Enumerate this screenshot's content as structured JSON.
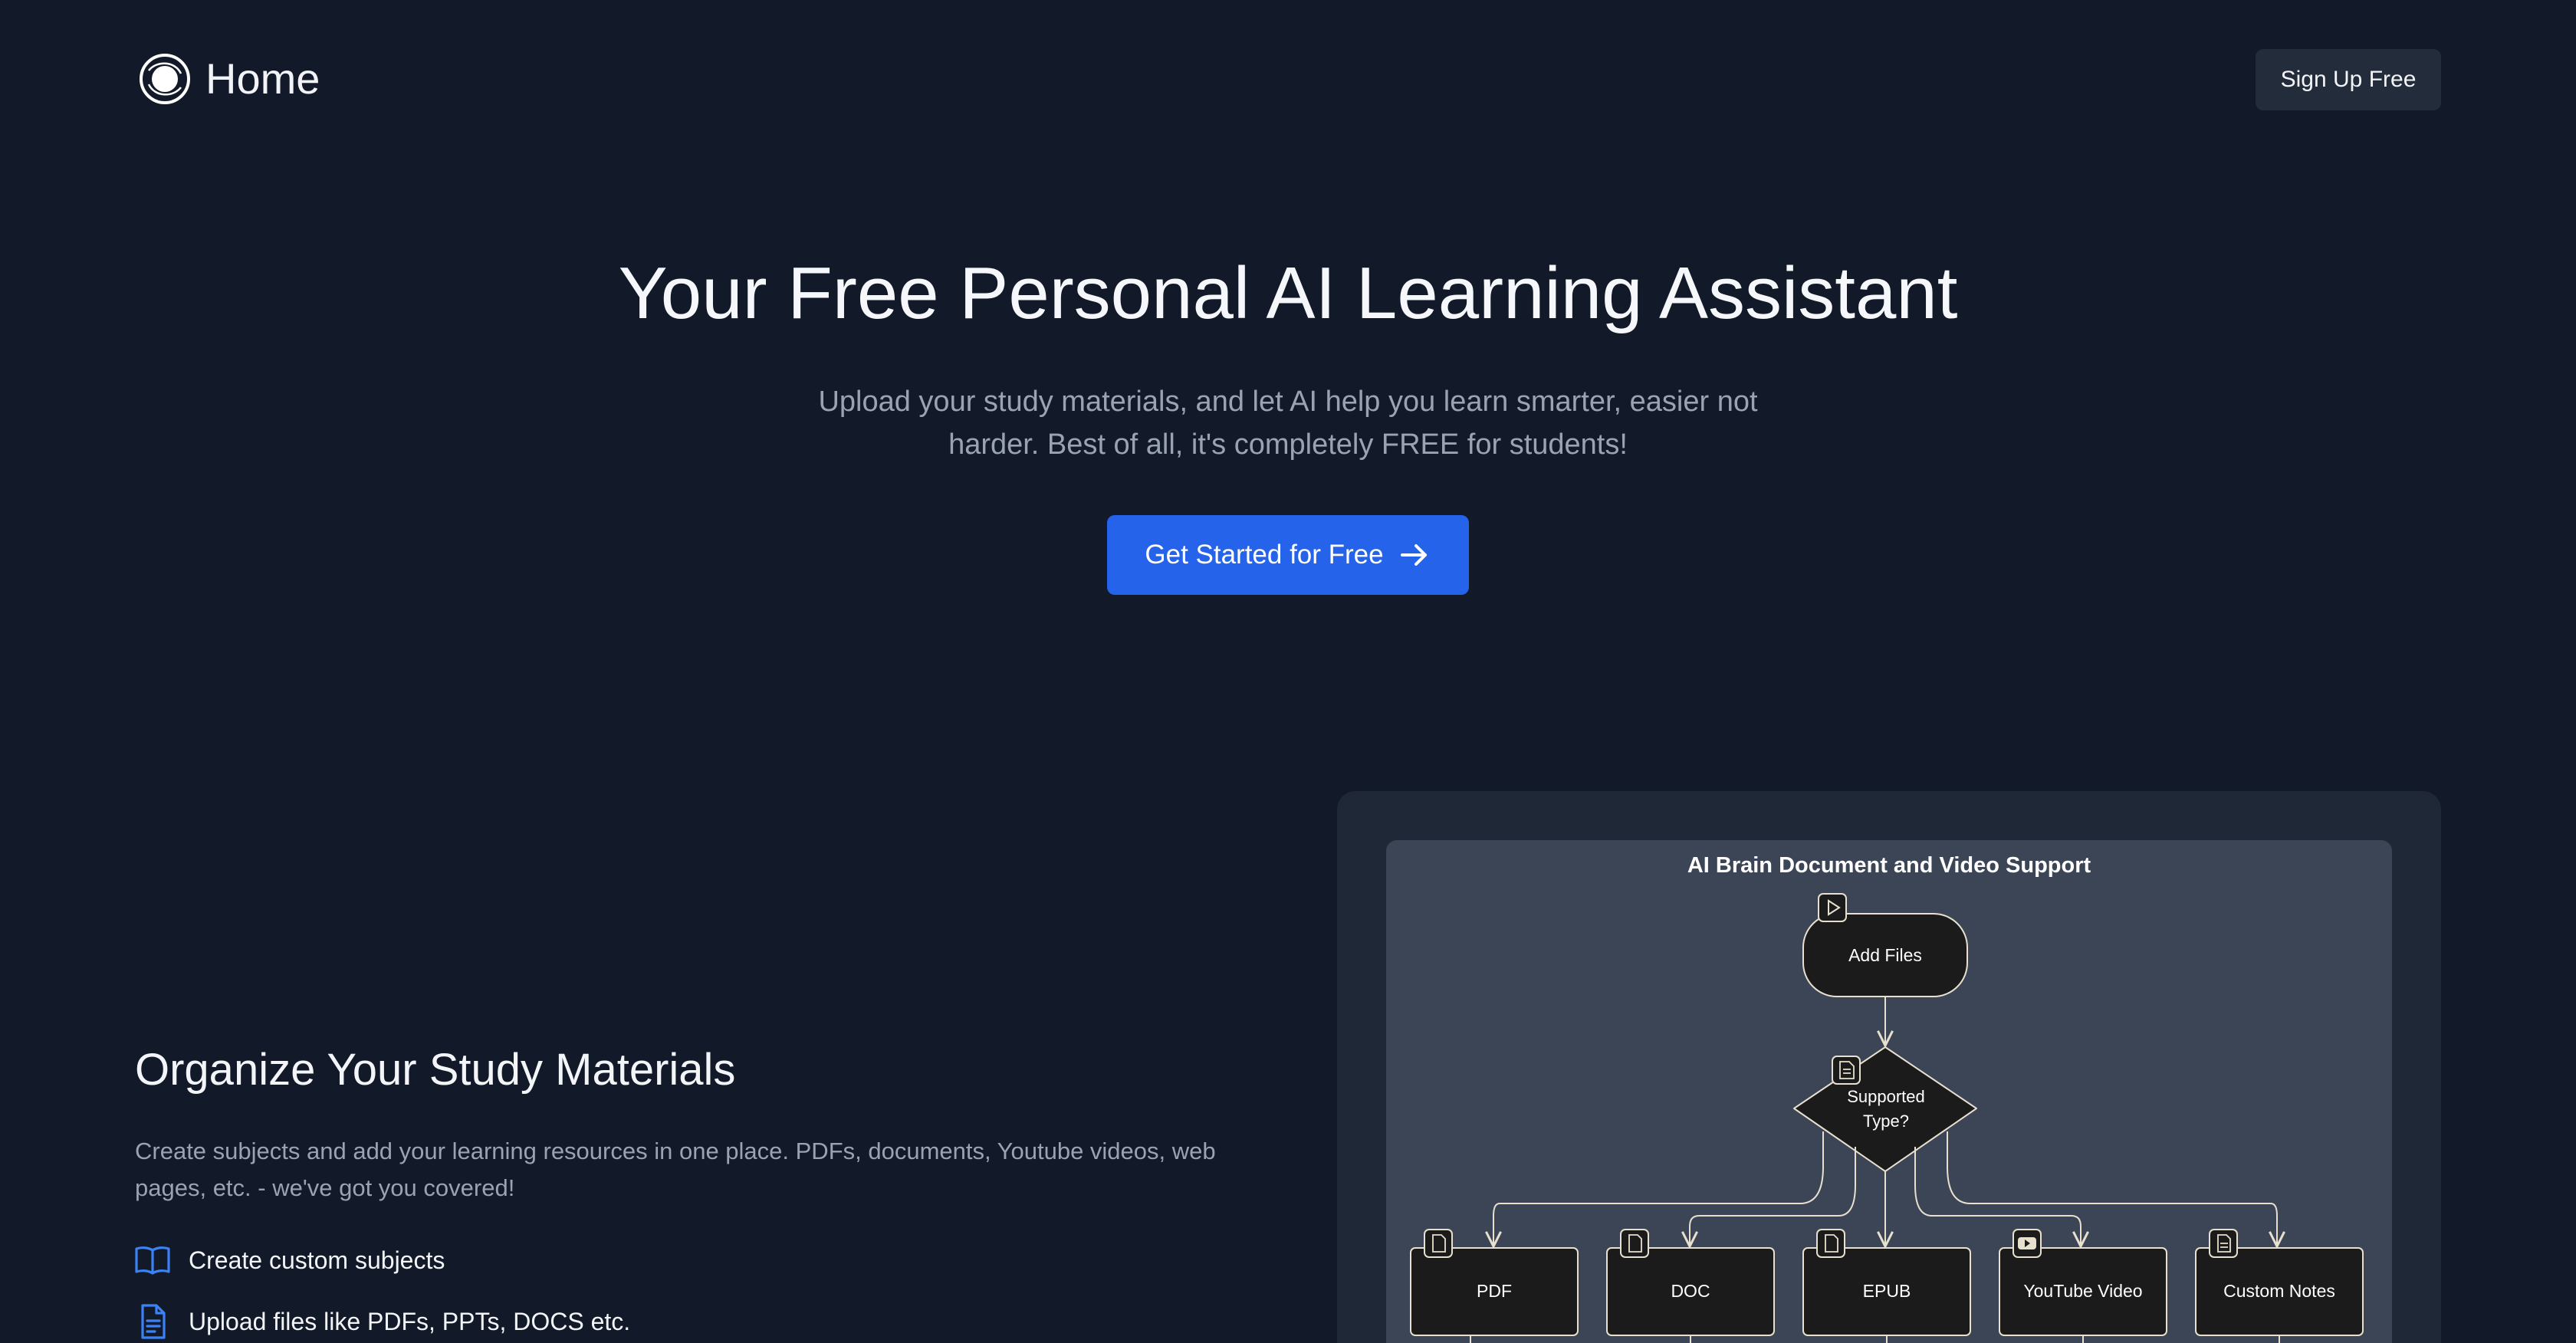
{
  "header": {
    "logo_label": "Home",
    "logo_icon": "brain-orbit-logo-icon",
    "signup_label": "Sign Up Free"
  },
  "hero": {
    "title": "Your Free Personal AI Learning Assistant",
    "subtitle": "Upload your study materials, and let AI help you learn smarter, easier not harder. Best of all, it's completely FREE for students!",
    "cta_label": "Get Started for Free",
    "cta_icon": "arrow-right-icon",
    "cta_color": "#2563eb"
  },
  "feature": {
    "title": "Organize Your Study Materials",
    "description": "Create subjects and add your learning resources in one place. PDFs, documents, Youtube videos, web pages, etc. - we've got you covered!",
    "items": [
      {
        "label": "Create custom subjects",
        "icon": "open-book-icon"
      },
      {
        "label": "Upload files like PDFs, PPTs, DOCS etc.",
        "icon": "document-icon"
      }
    ],
    "accent_color": "#3b82f6"
  },
  "diagram": {
    "title": "AI Brain Document and Video Support",
    "start_node": "Add Files",
    "decision_node": "Supported Type?",
    "decision_lines": [
      "Supported",
      "Type?"
    ],
    "branches": [
      "PDF",
      "DOC",
      "EPUB",
      "YouTube Video",
      "Custom Notes"
    ],
    "colors": {
      "background": "#3c4555",
      "node_fill": "#1b1b1b",
      "node_stroke": "#e8e0cf"
    }
  }
}
